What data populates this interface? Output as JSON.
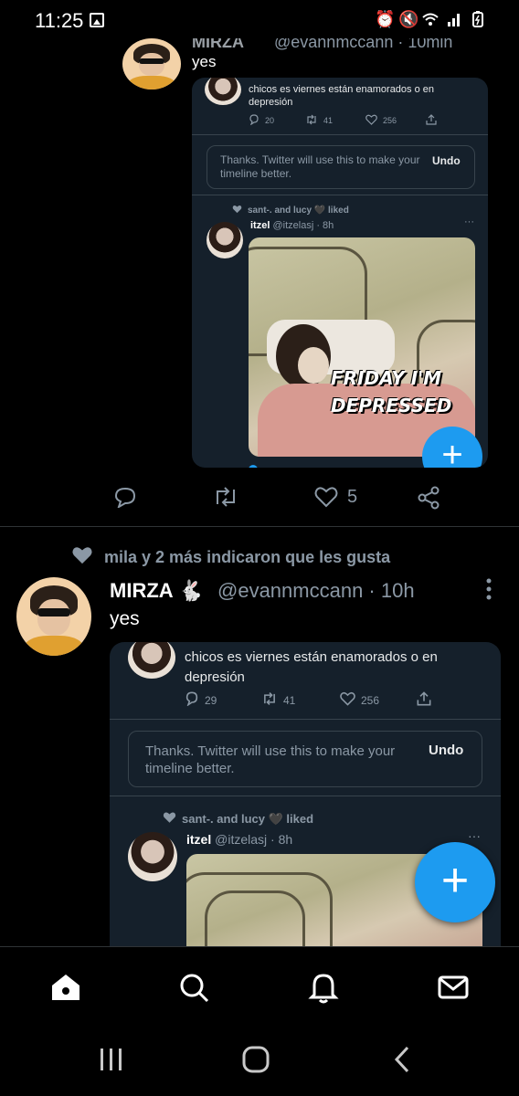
{
  "status_bar": {
    "time": "11:25",
    "icons": [
      "gallery-icon",
      "alarm-icon",
      "mute-icon",
      "wifi-icon",
      "signal-icon",
      "battery-icon"
    ]
  },
  "top_tweet": {
    "name_partial": "MIRZA",
    "handle_partial": "@evannmccann · 10min",
    "text": "yes",
    "screenshot": {
      "quote_text": "chicos es viernes están enamorados o en depresión",
      "stats": {
        "replies": "20",
        "retweets": "41",
        "likes": "256"
      },
      "undo_message": "Thanks. Twitter will use this to make your timeline better.",
      "undo_label": "Undo",
      "liked_by": "sant-. and lucy 🖤 liked",
      "inner_name": "itzel",
      "inner_handle": "@itzelasj · 8h",
      "meme_caption_line1": "FRIDAY I'M",
      "meme_caption_line2": "DEPRESSED"
    },
    "actions": {
      "likes": "5"
    }
  },
  "second_tweet": {
    "social_context": "mila y 2 más indicaron que les gusta",
    "name": "MIRZA 🐇",
    "handle": "@evannmccann · 10h",
    "text": "yes",
    "screenshot": {
      "quote_text": "chicos es viernes están enamorados o en depresión",
      "stats": {
        "replies": "29",
        "retweets": "41",
        "likes": "256"
      },
      "undo_message": "Thanks. Twitter will use this to make your timeline better.",
      "undo_label": "Undo",
      "liked_by": "sant-. and lucy 🖤 liked",
      "inner_name": "itzel",
      "inner_handle": "@itzelasj · 8h"
    }
  },
  "compose_fab": {
    "label": "+"
  },
  "bottom_nav": [
    "home-icon",
    "search-icon",
    "notifications-icon",
    "messages-icon"
  ],
  "colors": {
    "accent": "#1d9bf0",
    "background": "#000000",
    "card": "#15202b",
    "muted": "#8b98a5"
  }
}
